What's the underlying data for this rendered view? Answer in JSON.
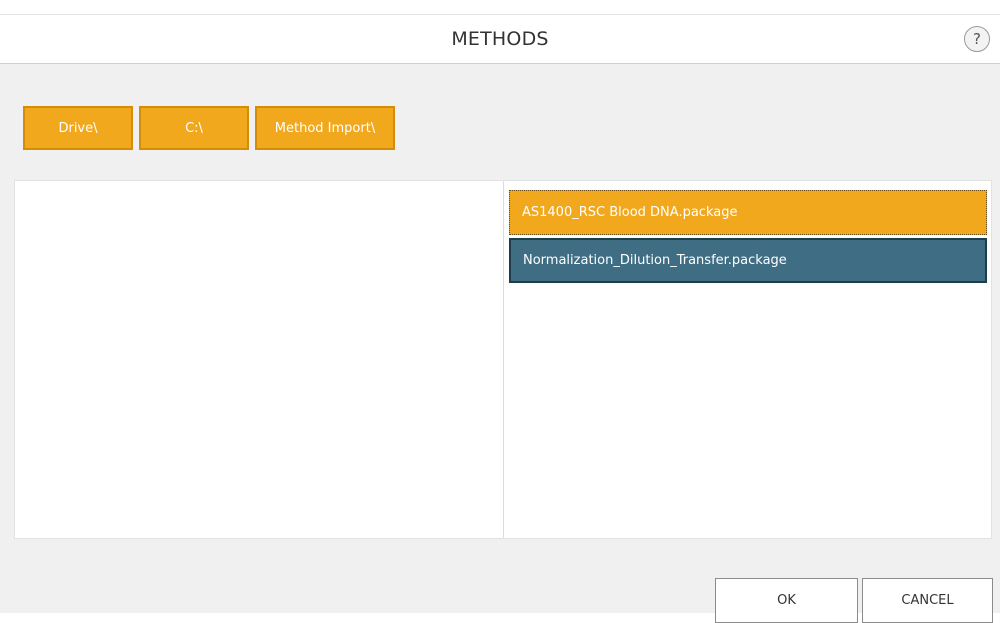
{
  "header": {
    "title": "METHODS",
    "help_label": "?"
  },
  "breadcrumbs": [
    {
      "label": "Drive\\"
    },
    {
      "label": "C:\\"
    },
    {
      "label": "Method Import\\"
    }
  ],
  "files": [
    {
      "name": "AS1400_RSC Blood DNA.package",
      "selected": true
    },
    {
      "name": "Normalization_Dilution_Transfer.package",
      "selected": false
    }
  ],
  "actions": {
    "ok_label": "OK",
    "cancel_label": "CANCEL"
  },
  "colors": {
    "accent_orange": "#f2a81d",
    "accent_blue": "#3f6e84",
    "body_background": "#f0f0f0"
  }
}
